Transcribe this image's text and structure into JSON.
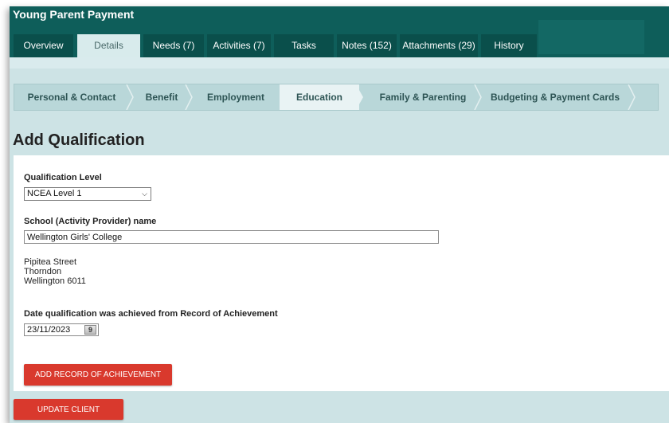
{
  "app": {
    "title": "Young Parent Payment"
  },
  "tabs": [
    {
      "label": "Overview"
    },
    {
      "label": "Details"
    },
    {
      "label": "Needs (7)"
    },
    {
      "label": "Activities (7)"
    },
    {
      "label": "Tasks"
    },
    {
      "label": "Notes (152)"
    },
    {
      "label": "Attachments (29)"
    },
    {
      "label": "History"
    }
  ],
  "steps": [
    {
      "label": "Personal & Contact"
    },
    {
      "label": "Benefit"
    },
    {
      "label": "Employment"
    },
    {
      "label": "Education"
    },
    {
      "label": "Family & Parenting"
    },
    {
      "label": "Budgeting & Payment Cards"
    }
  ],
  "form": {
    "title": "Add Qualification",
    "qualification_label": "Qualification Level",
    "qualification_value": "NCEA Level 1",
    "school_label": "School (Activity Provider) name",
    "school_value": "Wellington Girls' College",
    "address": [
      "Pipitea Street",
      "Thorndon",
      "Wellington 6011"
    ],
    "date_label": "Date qualification was achieved from Record of Achievement",
    "date_value": "23/11/2023",
    "calendar_icon_text": "9",
    "add_record_button": "ADD RECORD OF ACHIEVEMENT"
  },
  "actions": {
    "update_client": "UPDATE CLIENT"
  },
  "colors": {
    "header": "#0e5e5a",
    "tab_bg": "#0a4f4b",
    "active_tab": "#d8ebec",
    "background": "#cde3e5",
    "accent_red": "#d9392d"
  }
}
